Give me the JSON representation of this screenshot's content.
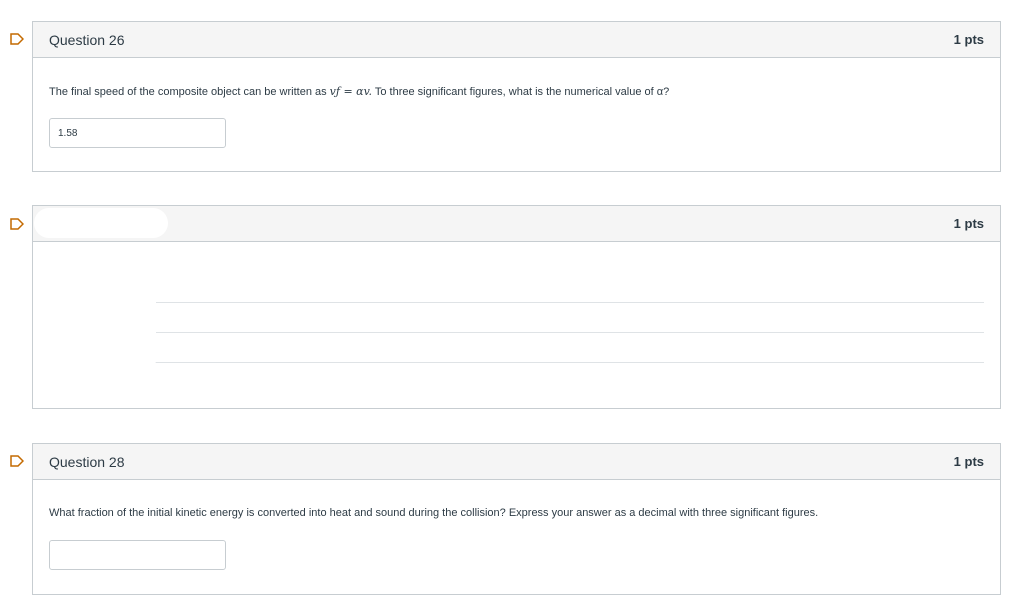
{
  "questions": [
    {
      "title": "Question 26",
      "points": "1 pts",
      "text_before": "The final speed of the composite object can be written as ",
      "formula": "vƒ = αv.",
      "text_after": " To three significant figures, what is the numerical value of α?",
      "answer_value": "1.58"
    },
    {
      "title": "",
      "points": "1 pts"
    },
    {
      "title": "Question 28",
      "points": "1 pts",
      "text": "What fraction of the initial kinetic energy is converted into heat and sound during the collision? Express your answer as a decimal with three significant figures.",
      "answer_value": ""
    }
  ],
  "colors": {
    "flag_outline": "#c46a00",
    "header_bg": "#f5f5f5",
    "border": "#c7cdd1",
    "text": "#2d3b45"
  },
  "icons": {
    "flag": "flag-outline-icon"
  }
}
